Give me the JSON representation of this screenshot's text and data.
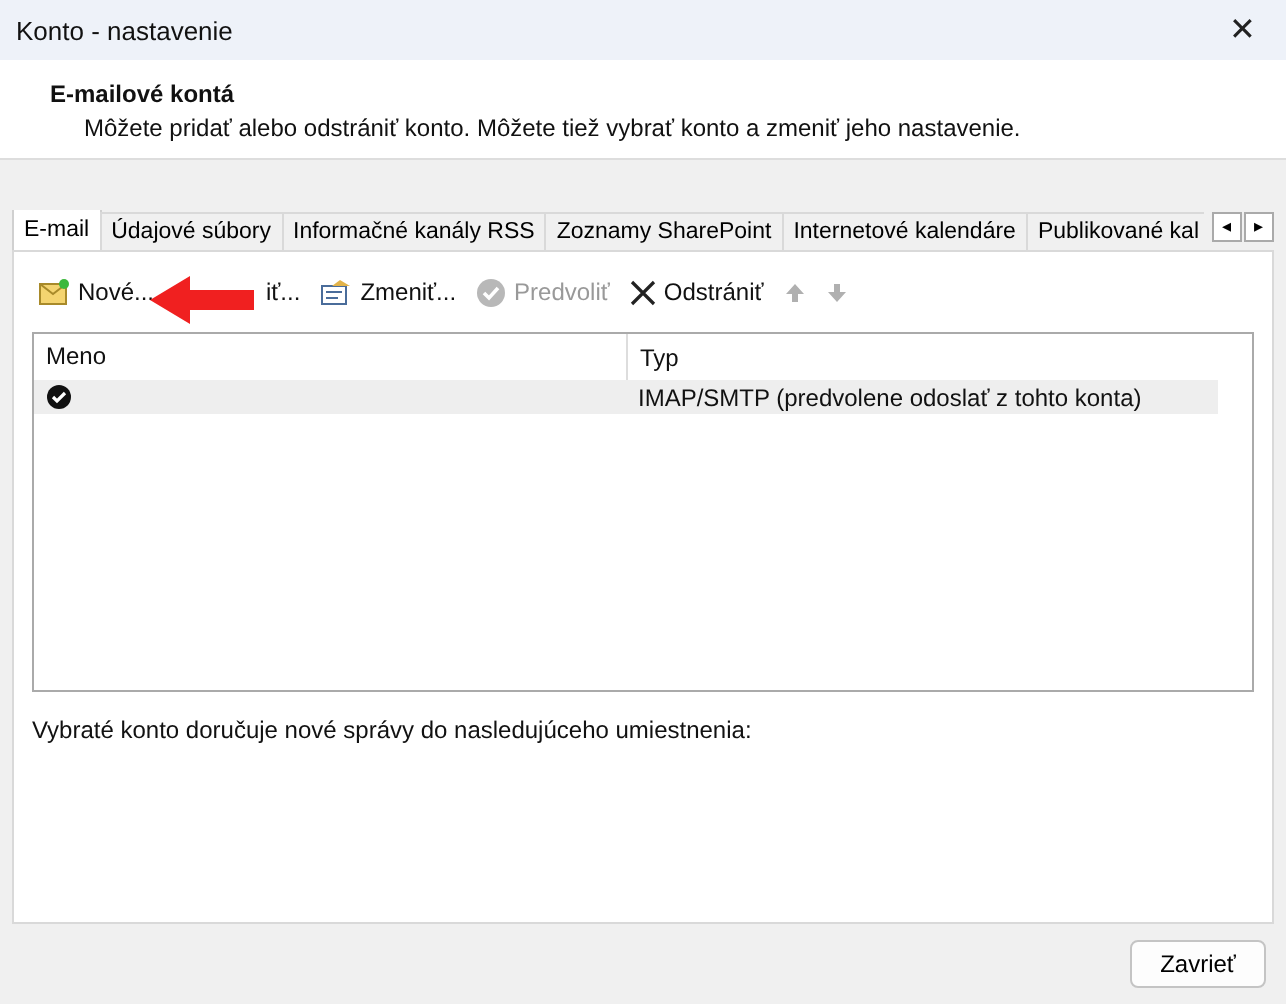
{
  "window": {
    "title": "Konto - nastavenie",
    "close": "✕"
  },
  "header": {
    "title": "E-mailové kontá",
    "description": "Môžete pridať alebo odstrániť konto. Môžete tiež vybrať konto a zmeniť jeho nastavenie."
  },
  "tabs": [
    {
      "label": "E-mail",
      "selected": true
    },
    {
      "label": "Údajové súbory",
      "selected": false
    },
    {
      "label": "Informačné kanály RSS",
      "selected": false
    },
    {
      "label": "Zoznamy SharePoint",
      "selected": false
    },
    {
      "label": "Internetové kalendáre",
      "selected": false
    },
    {
      "label": "Publikované kal",
      "selected": false
    }
  ],
  "tab_scroll": [
    "◂",
    "▸"
  ],
  "toolbar": [
    {
      "kind": "new",
      "label": "Nové...",
      "disabled": false
    },
    {
      "kind": "repair",
      "label": "iť...",
      "disabled": false
    },
    {
      "kind": "change",
      "label": "Zmeniť...",
      "disabled": false
    },
    {
      "kind": "default",
      "label": "Predvoliť",
      "disabled": true
    },
    {
      "kind": "remove",
      "label": "Odstrániť",
      "disabled": false
    },
    {
      "kind": "up",
      "disabled": true
    },
    {
      "kind": "down",
      "disabled": true
    }
  ],
  "table": {
    "columns": [
      "Meno",
      "Typ"
    ],
    "rows": [
      {
        "default": true,
        "type": "IMAP/SMTP (predvolene odoslať z tohto konta)",
        "selected": true
      }
    ]
  },
  "delivery_text": "Vybraté konto doručuje nové správy do nasledujúceho umiestnenia:",
  "annotation": {
    "kind": "arrow"
  },
  "buttons": [
    "Zavrieť"
  ]
}
